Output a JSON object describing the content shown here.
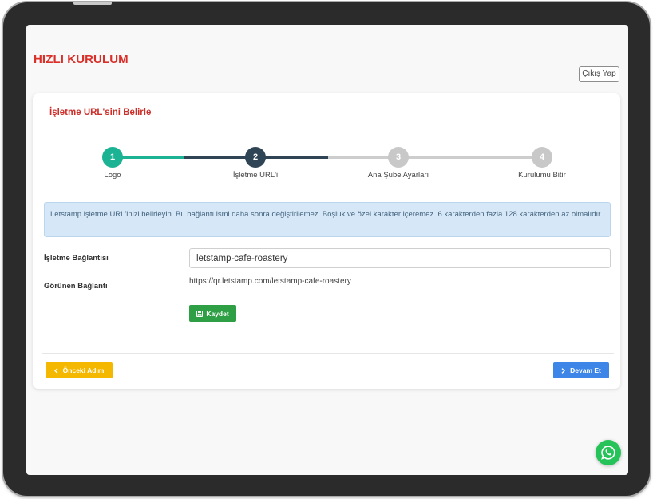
{
  "header": {
    "title": "HIZLI KURULUM",
    "logout_label": "Çıkış Yap"
  },
  "card": {
    "title": "İşletme URL'sini Belirle",
    "steps": [
      {
        "number": "1",
        "label": "Logo",
        "state": "completed",
        "color": "#1cb394"
      },
      {
        "number": "2",
        "label": "İşletme URL'i",
        "state": "active",
        "color": "#2f4455"
      },
      {
        "number": "3",
        "label": "Ana Şube Ayarları",
        "state": "pending",
        "color": "#c8c8c8"
      },
      {
        "number": "4",
        "label": "Kurulumu Bitir",
        "state": "pending",
        "color": "#c8c8c8"
      }
    ],
    "info": "Letstamp işletme URL'inizi belirleyin. Bu bağlantı ismi daha sonra değiştirilemez. Boşluk ve özel karakter içeremez. 6 karakterden fazla 128 karakterden az olmalıdır.",
    "form": {
      "link_label": "İşletme Bağlantısı",
      "link_value": "letstamp-cafe-roastery",
      "visible_label": "Görünen Bağlantı",
      "visible_value": "https://qr.letstamp.com/letstamp-cafe-roastery",
      "save_label": "Kaydet"
    },
    "footer": {
      "prev_label": "Önceki Adım",
      "next_label": "Devam Et"
    }
  },
  "icons": {
    "save": "floppy-disk-icon",
    "prev": "chevron-left-icon",
    "next": "chevron-right-icon",
    "whatsapp": "whatsapp-icon"
  },
  "colors": {
    "brand_red": "#d9302a",
    "save_green": "#2e9f44",
    "prev_yellow": "#f5b800",
    "next_blue": "#3d86e8",
    "whatsapp": "#25c35a"
  }
}
